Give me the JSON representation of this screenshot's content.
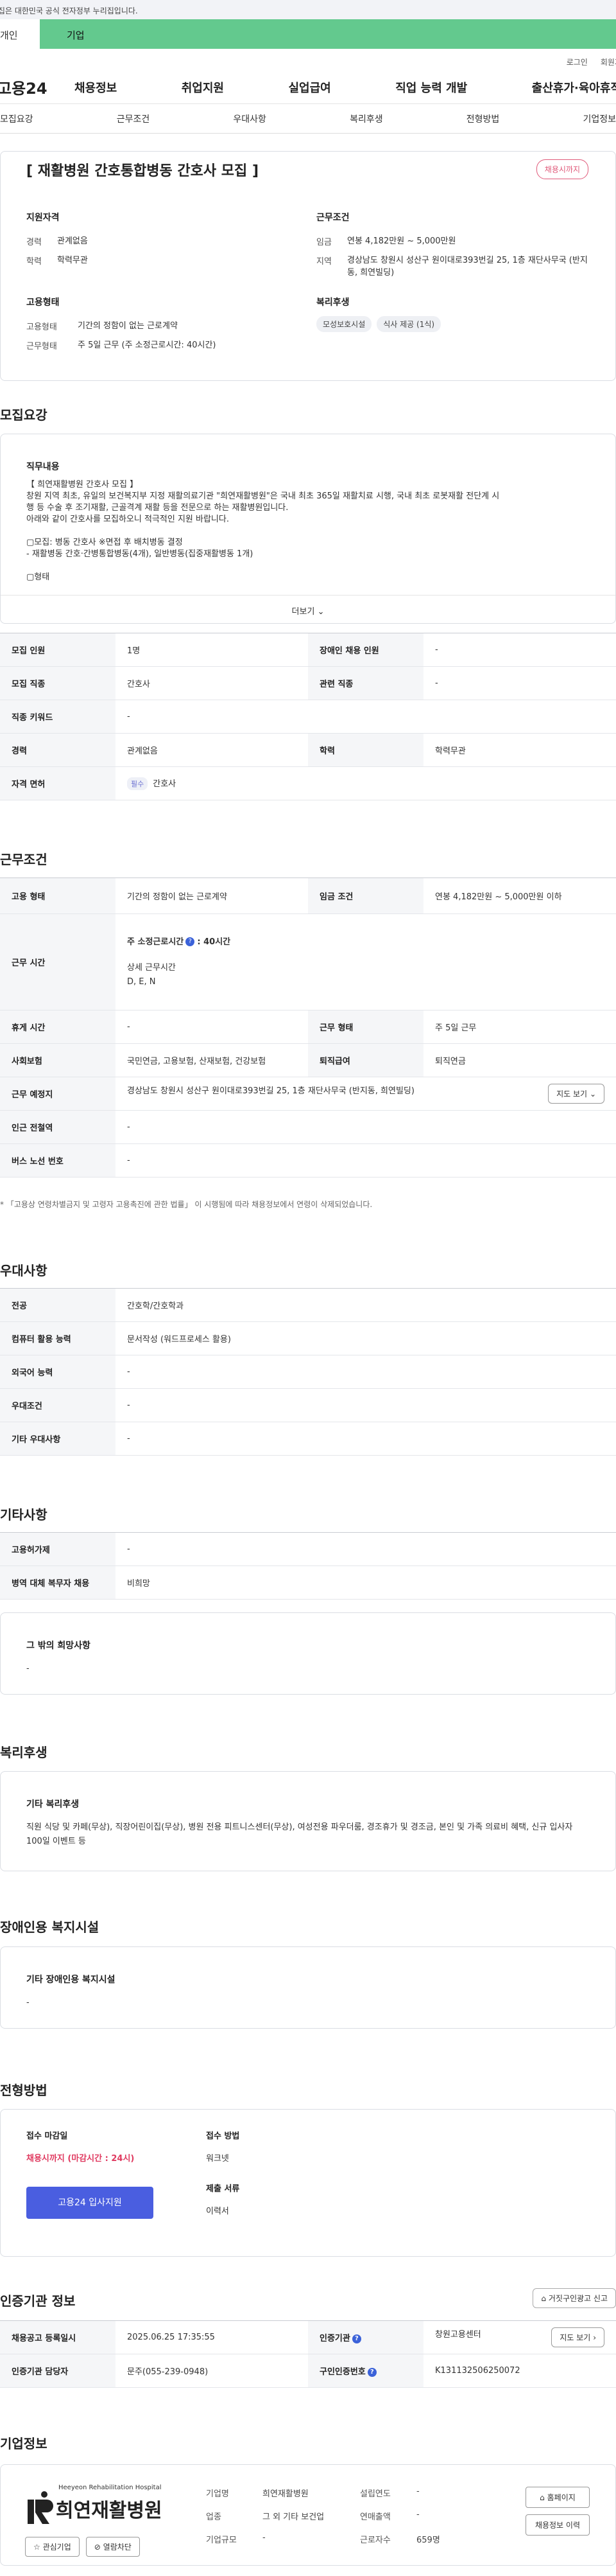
{
  "gov_bar": {
    "notice": "이 누리집은 대한민국 공식 전자정부 누리집입니다."
  },
  "segment": {
    "personal": "개인",
    "company": "기업"
  },
  "util": {
    "login": "로그인",
    "signup": "회원가입"
  },
  "gnb": {
    "logo": "고용24",
    "menu": [
      "채용정보",
      "취업지원",
      "실업급여",
      "직업 능력 개발",
      "출산휴가·육아휴직"
    ]
  },
  "anchors": [
    "모집요강",
    "근무조건",
    "우대사항",
    "복리후생",
    "전형방법",
    "기업정보"
  ],
  "header": {
    "title": "[ 재활병원 간호통합병동 간호사 모집 ]",
    "badge": "채용시까지",
    "qual": {
      "title": "지원자격",
      "career_k": "경력",
      "career_v": "관계없음",
      "edu_k": "학력",
      "edu_v": "학력무관"
    },
    "cond": {
      "title": "근무조건",
      "wage_k": "임금",
      "wage_v": "연봉 4,182만원 ~ 5,000만원",
      "loc_k": "지역",
      "loc_v": "경상남도 창원시 성산구 원이대로393번길 25, 1층 재단사무국 (반지동, 희연빌딩)"
    },
    "emp": {
      "title": "고용형태",
      "type_k": "고용형태",
      "type_v": "기간의 정함이 없는 근로계약",
      "shape_k": "근무형태",
      "shape_v": "주 5일 근무 (주 소정근로시간: 40시간)"
    },
    "welfare": {
      "title": "복리후생",
      "chips": [
        "모성보호시설",
        "식사 제공 (1식)"
      ]
    }
  },
  "recruit": {
    "section_title": "모집요강",
    "desc_label": "직무내용",
    "desc_text": "【 희연재활병원 간호사 모집 】\n창원 지역 최초, 유일의 보건복지부 지정 재활의료기관 \"희연재활병원\"은 국내 최초 365일 재활치료 시행, 국내 최초 로봇재활 전단계 시\n행 등 수술 후 조기재활, 근골격계 재활 등을 전문으로 하는 재활병원입니다.\n아래와 같이 간호사를 모집하오니 적극적인 지원 바랍니다.\n\n▢모집: 병동 간호사 ※면접 후 배치병동 결정\n- 재활병동 간호·간병통합병동(4개), 일반병동(집중재활병동 1개)\n\n▢형태",
    "more": "더보기",
    "rows": {
      "count_k": "모집 인원",
      "count_v": "1명",
      "dis_k": "장애인 채용 인원",
      "dis_v": "-",
      "job_k": "모집 직종",
      "job_v": "간호사",
      "rel_k": "관련 직종",
      "rel_v": "-",
      "kw_k": "직종 키워드",
      "kw_v": "-",
      "car_k": "경력",
      "car_v": "관계없음",
      "edu_k": "학력",
      "edu_v": "학력무관",
      "lic_k": "자격 면허",
      "lic_tag": "필수",
      "lic_v": "간호사"
    }
  },
  "work": {
    "section_title": "근무조건",
    "type_k": "고용 형태",
    "type_v": "기간의 정함이 없는 근로계약",
    "wage_k": "임금 조건",
    "wage_v": "연봉 4,182만원 ~ 5,000만원 이하",
    "time_k": "근무 시간",
    "time_hours": "주 소정근로시간",
    "time_hours_v": ": 40시간",
    "time_detail_k": "상세 근무시간",
    "time_detail_v": "D, E, N",
    "break_k": "휴게 시간",
    "break_v": "-",
    "shape_k": "근무 형태",
    "shape_v": "주 5일 근무",
    "ins_k": "사회보험",
    "ins_v": "국민연금, 고용보험, 산재보험, 건강보험",
    "ret_k": "퇴직급여",
    "ret_v": "퇴직연금",
    "place_k": "근무 예정지",
    "place_v": "경상남도 창원시 성산구 원이대로393번길 25, 1층 재단사무국 (반지동, 희연빌딩)",
    "map_btn": "지도 보기",
    "station_k": "인근 전철역",
    "station_v": "-",
    "bus_k": "버스 노선 번호",
    "bus_v": "-",
    "note": "* 「고용상 연령차별금지 및 고령자 고용촉진에 관한 법률」 이 시행됨에 따라 채용정보에서 연령이 삭제되었습니다."
  },
  "pref": {
    "section_title": "우대사항",
    "major_k": "전공",
    "major_v": "간호학/간호학과",
    "comp_k": "컴퓨터 활용 능력",
    "comp_v": "문서작성 (워드프로세스 활용)",
    "lang_k": "외국어 능력",
    "lang_v": "-",
    "cond_k": "우대조건",
    "cond_v": "-",
    "etc_k": "기타 우대사항",
    "etc_v": "-"
  },
  "etc": {
    "section_title": "기타사항",
    "welfare_k": "고용허가제",
    "welfare_v": "-",
    "mil_k": "병역 대체 복무자 채용",
    "mil_v": "비희망",
    "hope_label": "그 밖의 희망사항",
    "hope_v": "-"
  },
  "benefit": {
    "section_title": "복리후생",
    "label": "기타 복리후생",
    "text": "직원 식당 및 카페(무상), 직장어린이집(무상), 병원 전용 피트니스센터(무상), 여성전용 파우더룸, 경조휴가 및 경조금, 본인 및 가족 의료비 혜택, 신규 입사자 100일 이벤트 등"
  },
  "disabled": {
    "section_title": "장애인용 복지시설",
    "label": "기타 장애인용 복지시설",
    "text": "-"
  },
  "process": {
    "section_title": "전형방법",
    "deadline_label": "접수 마감일",
    "deadline_v": "채용시까지 (마감시간 : 24시)",
    "apply_btn": "고용24 입사지원",
    "method_label": "접수 방법",
    "method_v": "워크넷",
    "docs_label": "제출 서류",
    "docs_v": "이력서"
  },
  "agency": {
    "section_title": "인증기관 정보",
    "report_btn": "거짓구인광고 신고",
    "reg_k": "채용공고 등록일시",
    "reg_v": "2025.06.25 17:35:55",
    "org_k": "인증기관",
    "org_v": "창원고용센터",
    "map_btn": "지도 보기",
    "mgr_k": "인증기관 담당자",
    "mgr_v": "문주(055-239-0948)",
    "id_k": "구인인증번호",
    "id_v": "K131132506250072"
  },
  "company": {
    "section_title": "기업정보",
    "logo_eng": "Heeyeon Rehabilitation Hospital",
    "logo_kor": "희연재활병원",
    "interest_btn": "관심기업",
    "block_btn": "열람차단",
    "name_k": "기업명",
    "name_v": "희연재활병원",
    "ind_k": "업종",
    "ind_v": "그 외 기타 보건업",
    "size_k": "기업규모",
    "size_v": "-",
    "year_k": "설립연도",
    "year_v": "-",
    "rev_k": "연매출액",
    "rev_v": "-",
    "emp_k": "근로자수",
    "emp_v": "659명",
    "home_btn": "홈페이지",
    "jobs_btn": "채용정보 이력"
  },
  "colors": {
    "accent_green": "#63c98e",
    "apply_blue": "#4a5ee0",
    "deadline_red": "#e03a60",
    "badge_pink": "#e05a7a"
  }
}
